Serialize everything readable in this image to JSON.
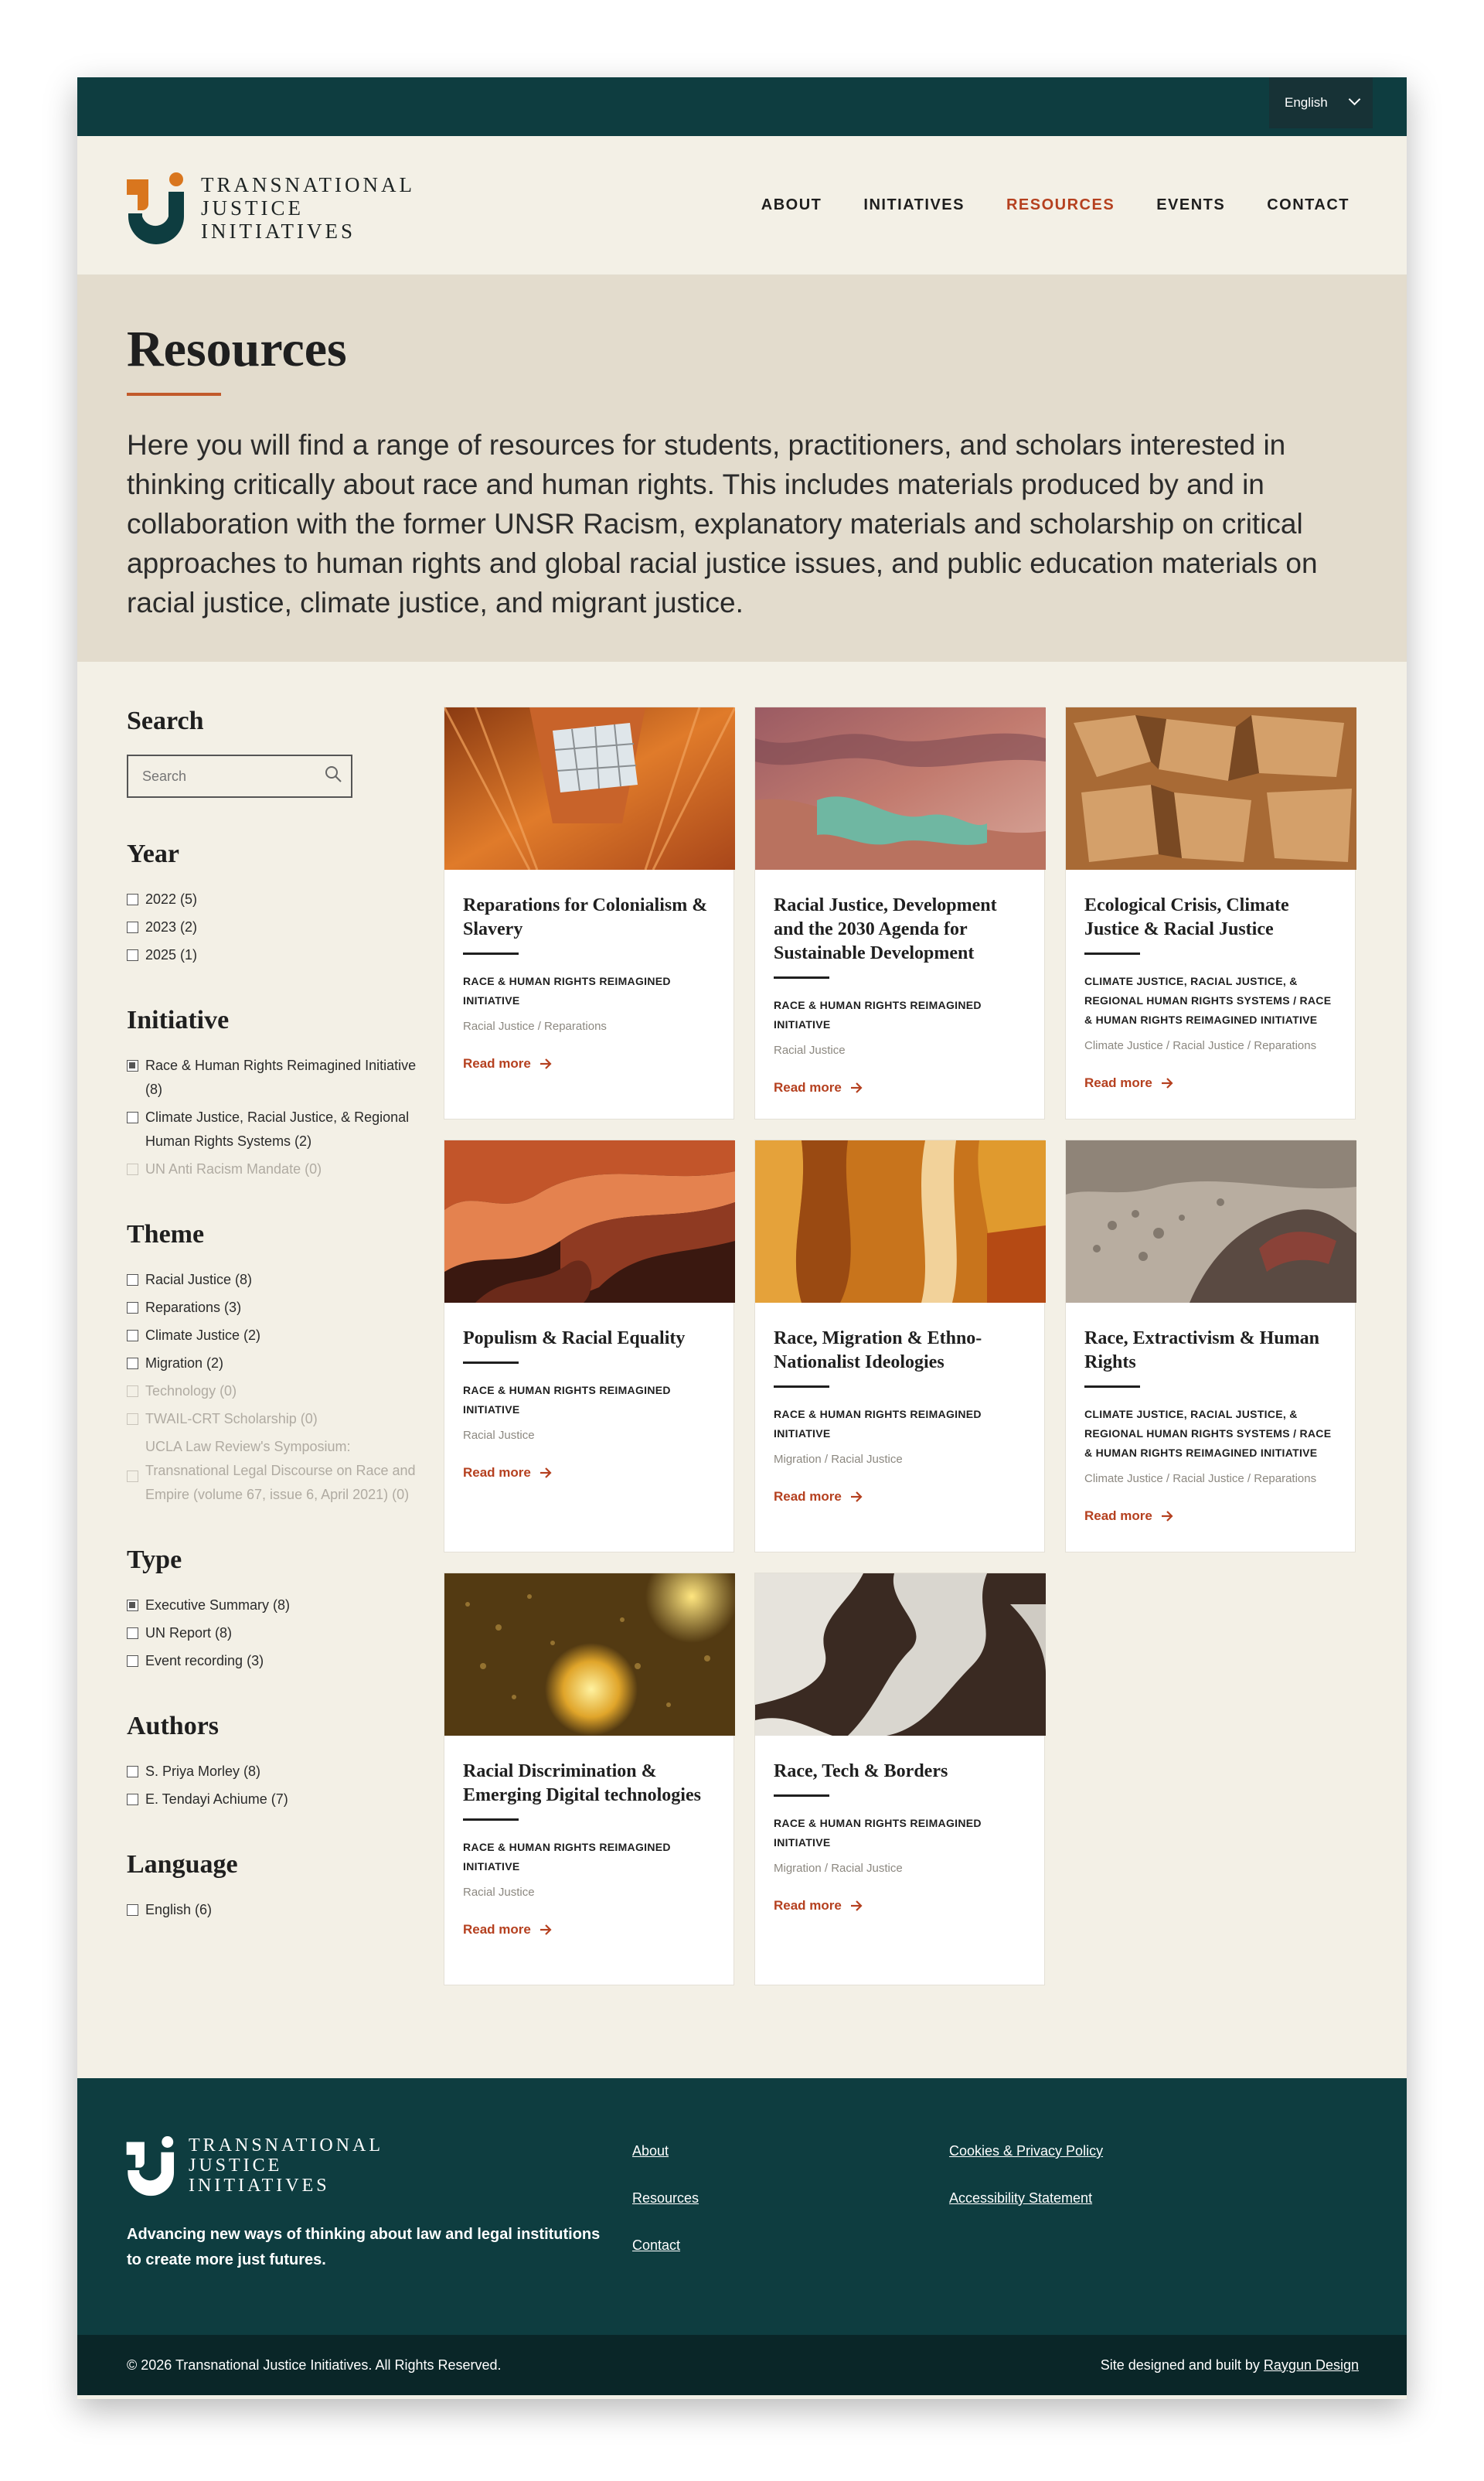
{
  "language_selector": {
    "value": "English"
  },
  "brand": {
    "line1": "TRANSNATIONAL",
    "line2": "JUSTICE",
    "line3": "INITIATIVES"
  },
  "nav": [
    {
      "label": "ABOUT"
    },
    {
      "label": "INITIATIVES"
    },
    {
      "label": "RESOURCES"
    },
    {
      "label": "EVENTS"
    },
    {
      "label": "CONTACT"
    }
  ],
  "nav_active": "RESOURCES",
  "hero": {
    "title": "Resources",
    "intro": "Here you will find a range of resources for students, practitioners, and scholars interested in thinking critically about race and human rights. This includes materials produced by and in collaboration with the former UNSR Racism, explanatory materials and scholarship on critical approaches to human rights and global racial justice issues, and public education materials on racial justice, climate justice, and migrant justice."
  },
  "sidebar": {
    "search_heading": "Search",
    "search_placeholder": "Search",
    "year_heading": "Year",
    "years": [
      {
        "label": "2022 (5)"
      },
      {
        "label": "2023 (2)"
      },
      {
        "label": "2025 (1)"
      }
    ],
    "initiative_heading": "Initiative",
    "initiatives": [
      {
        "label": "Race & Human Rights Reimagined Initiative (8)"
      },
      {
        "label": "Climate Justice, Racial Justice, & Regional Human Rights Systems (2)"
      },
      {
        "label": "UN Anti Racism Mandate (0)"
      }
    ],
    "theme_heading": "Theme",
    "themes": [
      {
        "label": "Racial Justice (8)"
      },
      {
        "label": "Reparations (3)"
      },
      {
        "label": "Climate Justice (2)"
      },
      {
        "label": "Migration (2)"
      },
      {
        "label": "Technology (0)"
      },
      {
        "label": "TWAIL-CRT Scholarship (0)"
      },
      {
        "label": "UCLA Law Review's Symposium: Transnational Legal Discourse on Race and Empire (volume 67, issue 6, April 2021) (0)"
      }
    ],
    "type_heading": "Type",
    "types": [
      {
        "label": "Executive Summary (8)"
      },
      {
        "label": "UN Report (8)"
      },
      {
        "label": "Event recording (3)"
      }
    ],
    "authors_heading": "Authors",
    "authors": [
      {
        "label": "S. Priya Morley (8)"
      },
      {
        "label": "E. Tendayi Achiume (7)"
      }
    ],
    "language_heading": "Language",
    "languages": [
      {
        "label": "English (6)"
      }
    ]
  },
  "read_more_label": "Read more",
  "cards": [
    {
      "title": "Reparations for Colonialism & Slavery",
      "initiative": "RACE & HUMAN RIGHTS REIMAGINED INITIATIVE",
      "themes": "Racial Justice / Reparations"
    },
    {
      "title": "Racial Justice, Development and the 2030 Agenda for Sustainable Development",
      "initiative": "RACE & HUMAN RIGHTS REIMAGINED INITIATIVE",
      "themes": "Racial Justice"
    },
    {
      "title": "Ecological Crisis, Climate Justice & Racial Justice",
      "initiative": "CLIMATE JUSTICE, RACIAL JUSTICE, & REGIONAL HUMAN RIGHTS SYSTEMS / RACE & HUMAN RIGHTS REIMAGINED INITIATIVE",
      "themes": "Climate Justice / Racial Justice / Reparations"
    },
    {
      "title": "Populism & Racial Equality",
      "initiative": "RACE & HUMAN RIGHTS REIMAGINED INITIATIVE",
      "themes": "Racial Justice"
    },
    {
      "title": "Race, Migration & Ethno-Nationalist Ideologies",
      "initiative": "RACE & HUMAN RIGHTS REIMAGINED INITIATIVE",
      "themes": "Migration / Racial Justice"
    },
    {
      "title": "Race, Extractivism & Human Rights",
      "initiative": "CLIMATE JUSTICE, RACIAL JUSTICE, & REGIONAL HUMAN RIGHTS SYSTEMS / RACE & HUMAN RIGHTS REIMAGINED INITIATIVE",
      "themes": "Climate Justice / Racial Justice / Reparations"
    },
    {
      "title": "Racial Discrimination & Emerging Digital technologies",
      "initiative": "RACE & HUMAN RIGHTS REIMAGINED INITIATIVE",
      "themes": "Racial Justice"
    },
    {
      "title": "Race, Tech & Borders",
      "initiative": "RACE & HUMAN RIGHTS REIMAGINED INITIATIVE",
      "themes": "Migration / Racial Justice"
    }
  ],
  "footer": {
    "tagline": "Advancing new ways of thinking about law and legal institutions to create more just futures.",
    "links_col1": [
      {
        "label": "About"
      },
      {
        "label": "Resources"
      },
      {
        "label": "Contact"
      }
    ],
    "links_col2": [
      {
        "label": "Cookies & Privacy Policy"
      },
      {
        "label": "Accessibility Statement"
      }
    ],
    "copyright": "© 2026 Transnational Justice Initiatives. All Rights Reserved.",
    "credit_prefix": "Site designed and built by ",
    "credit_link": "Raygun Design"
  },
  "colors": {
    "teal": "#0e3d40",
    "accent": "#b5401f",
    "logo_orange": "#d9761e",
    "cream": "#f3f0e6",
    "hero_bg": "#e3dccd"
  },
  "icons": {
    "search": "search-icon",
    "chevron": "chevron-down-icon",
    "arrow": "arrow-right-icon"
  }
}
